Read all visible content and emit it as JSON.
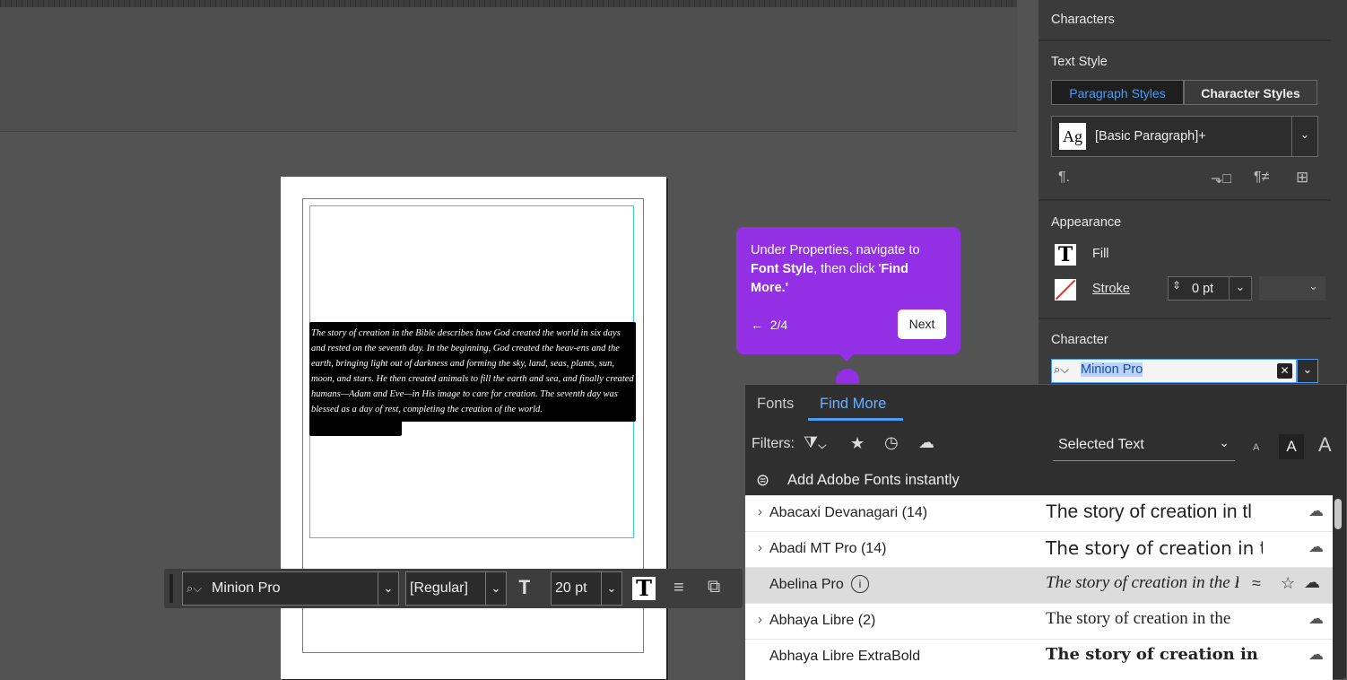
{
  "document": {
    "story_text": "The story of creation in the Bible describes how God created the world in six days and rested on the seventh day. In the beginning, God created the heav-ens and the earth, bringing light out of darkness and forming the sky, land, seas, plants, sun, moon, and stars. He then created animals to fill the earth and sea, and finally created humans—Adam and Eve—in His image to care for creation. The seventh day was blessed as a day of rest, completing the creation of the world."
  },
  "coach_mark": {
    "message_pre": "Under Properties, navigate to ",
    "message_bold1": "Font Style",
    "message_mid": ", then click '",
    "message_bold2": "Find More.",
    "message_post": "'",
    "step": "2/4",
    "back_arrow": "←",
    "next_label": "Next"
  },
  "control_bar": {
    "font_family": "Minion Pro",
    "font_style": "[Regular]",
    "font_size": "20 pt"
  },
  "properties_panel": {
    "characters_label": "Characters",
    "text_style_label": "Text Style",
    "paragraph_styles_tab": "Paragraph Styles",
    "character_styles_tab": "Character Styles",
    "style_preview": "Ag",
    "selected_style": "[Basic Paragraph]+",
    "appearance_label": "Appearance",
    "fill_label": "Fill",
    "stroke_label": "Stroke",
    "stroke_weight": "0 pt",
    "character_label": "Character",
    "font_search_value": "Minion Pro"
  },
  "font_panel": {
    "tabs": [
      "Fonts",
      "Find More"
    ],
    "active_tab": "Find More",
    "filters_label": "Filters:",
    "preview_select": "Selected Text",
    "add_fonts_label": "Add Adobe Fonts instantly",
    "size_labels": [
      "A",
      "A",
      "A"
    ],
    "fonts": [
      {
        "name": "Abacaxi Devanagari (14)",
        "expandable": true,
        "sample": "The story of creation in tl"
      },
      {
        "name": "Abadi MT Pro (14)",
        "expandable": true,
        "sample": "The story of creation in th"
      },
      {
        "name": "Abelina Pro",
        "expandable": false,
        "sample": "The story of creation in the B"
      },
      {
        "name": "Abhaya Libre (2)",
        "expandable": true,
        "sample": "The story of creation in the"
      },
      {
        "name": "Abhaya Libre ExtraBold",
        "expandable": false,
        "sample": "The story of creation in the"
      }
    ]
  },
  "colors": {
    "accent_purple": "#9330e6",
    "accent_blue": "#4b9cf5",
    "canvas": "#535353",
    "panel": "#3b3b3b"
  }
}
